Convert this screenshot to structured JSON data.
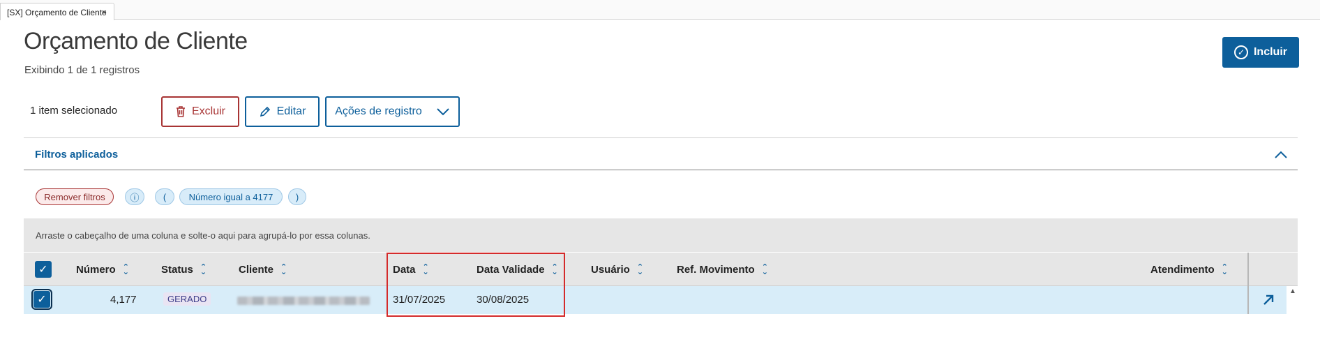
{
  "tab": {
    "label": "[SX] Orçamento de Cliente",
    "close": "×"
  },
  "page": {
    "title": "Orçamento de Cliente",
    "subtitle": "Exibindo 1 de 1 registros"
  },
  "toolbar": {
    "include_label": "Incluir",
    "selected_text": "1 item selecionado",
    "delete_label": "Excluir",
    "edit_label": "Editar",
    "actions_label": "Ações de registro"
  },
  "filters": {
    "title": "Filtros aplicados",
    "remove_label": "Remover filtros",
    "open_paren": "(",
    "condition": "Número igual a 4177",
    "close_paren": ")"
  },
  "grid": {
    "group_hint": "Arraste o cabeçalho de uma coluna e solte-o aqui para agrupá-lo por essa colunas.",
    "columns": [
      "Número",
      "Status",
      "Cliente",
      "Data",
      "Data Validade",
      "Usuário",
      "Ref. Movimento",
      "Atendimento"
    ],
    "rows": [
      {
        "numero": "4,177",
        "status": "GERADO",
        "cliente": "",
        "data": "31/07/2025",
        "data_validade": "30/08/2025",
        "usuario": "",
        "ref_movimento": "",
        "atendimento": ""
      }
    ]
  },
  "colors": {
    "primary": "#0d5f9b",
    "danger": "#a83434",
    "row_selected": "#d8edf9",
    "highlight": "#d42b2b"
  },
  "icons": [
    "close-icon",
    "check-circle-icon",
    "trash-icon",
    "pencil-icon",
    "chevron-down-icon",
    "chevron-up-icon",
    "info-icon",
    "sort-icon",
    "checkbox-icon",
    "open-record-icon"
  ]
}
